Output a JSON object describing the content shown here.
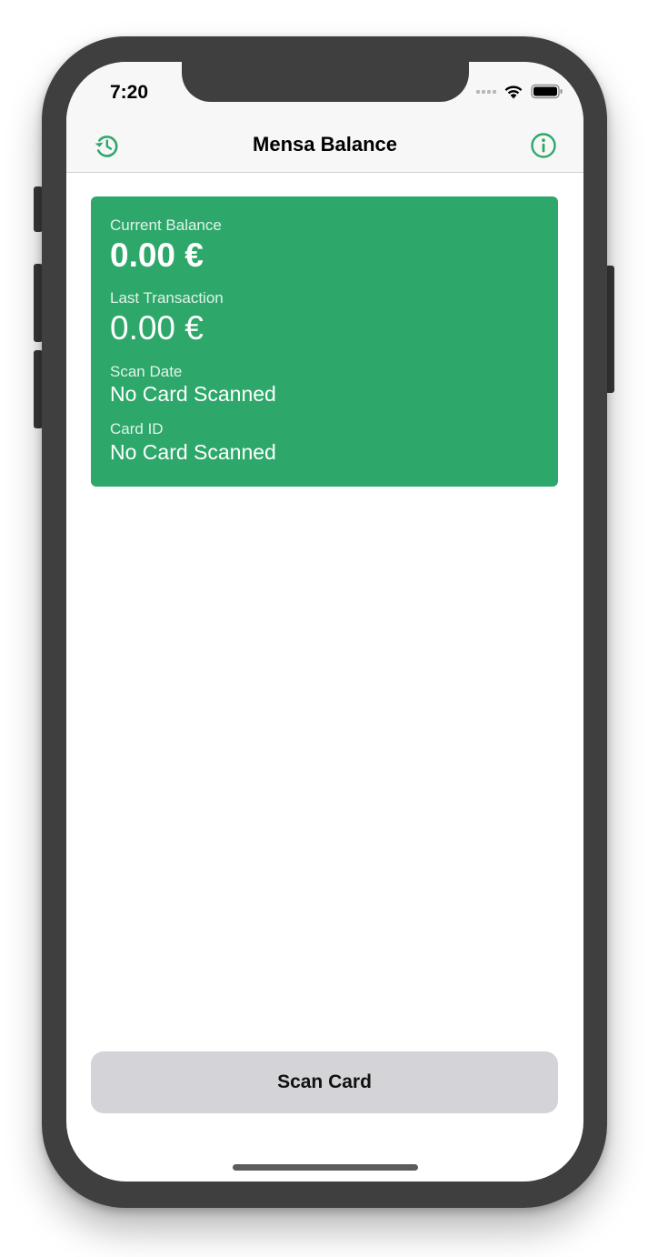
{
  "status_bar": {
    "time": "7:20"
  },
  "nav": {
    "title": "Mensa Balance",
    "left_icon": "history-icon",
    "right_icon": "info-icon"
  },
  "card": {
    "balance_label": "Current Balance",
    "balance_value": "0.00 €",
    "last_transaction_label": "Last Transaction",
    "last_transaction_value": "0.00 €",
    "scan_date_label": "Scan Date",
    "scan_date_value": "No Card Scanned",
    "card_id_label": "Card ID",
    "card_id_value": "No Card Scanned"
  },
  "actions": {
    "scan_label": "Scan Card"
  },
  "colors": {
    "accent": "#2da86a",
    "card_background": "#2da86a",
    "button_background": "#d3d3d8",
    "nav_background": "#f7f7f7",
    "frame": "#3f3f3f"
  }
}
